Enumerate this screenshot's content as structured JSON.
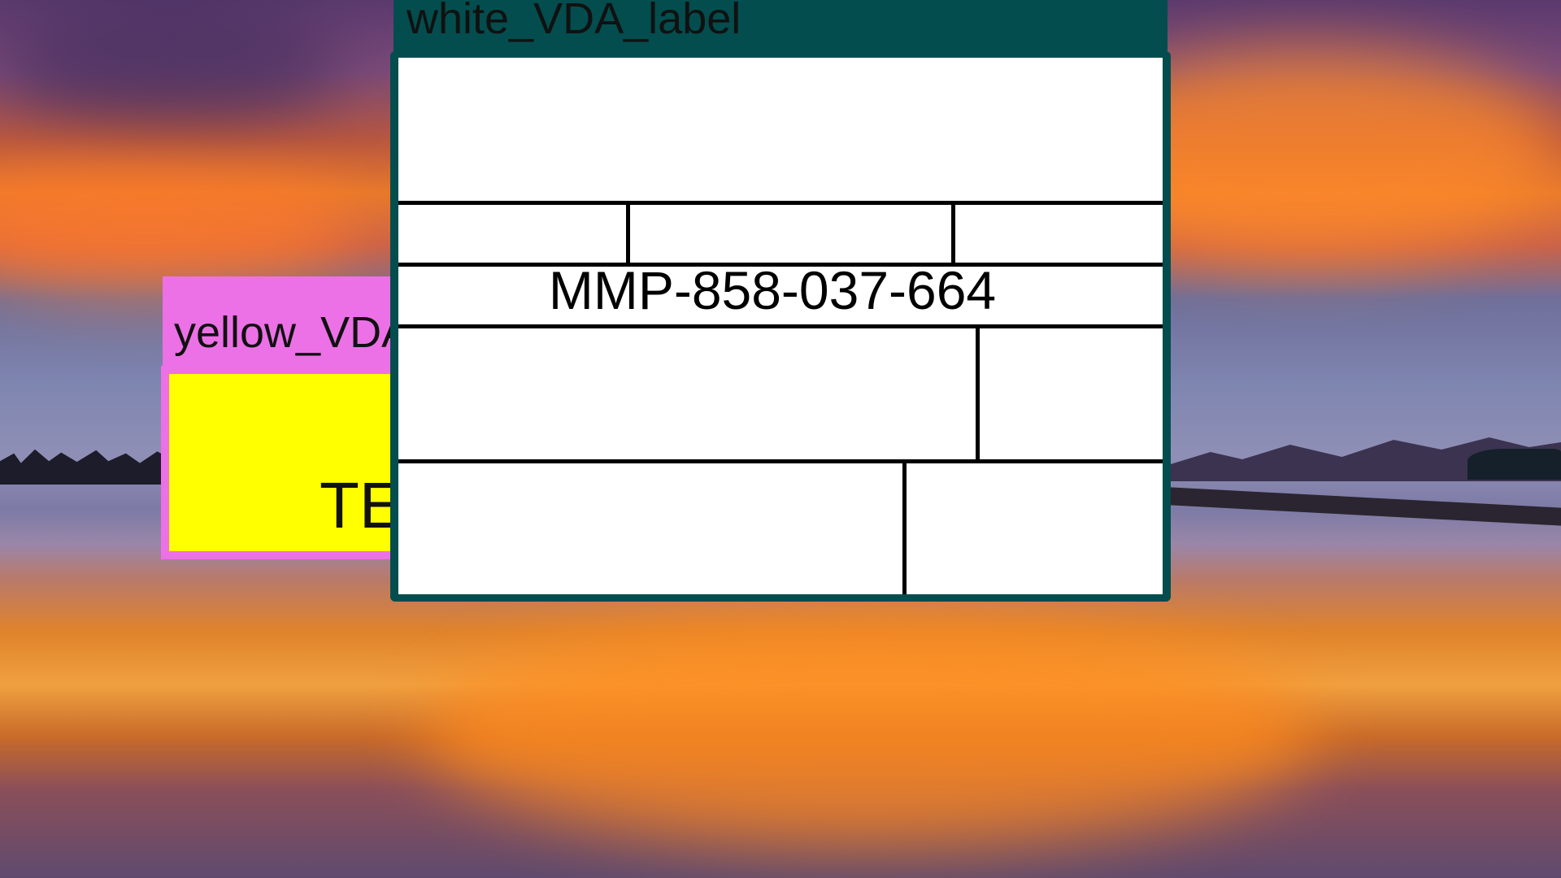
{
  "desktop": {
    "wallpaper": "sunset-lake-wallpaper"
  },
  "yellow_window": {
    "title": "yellow_VDA_label",
    "content_text": "TEXT",
    "titlebar_color": "#ec71e6",
    "body_color": "#ffff00"
  },
  "white_window": {
    "title": "white_VDA_label",
    "code": "MMP-858-037-664",
    "titlebar_color": "#034d4e",
    "body_color": "#ffffff"
  }
}
